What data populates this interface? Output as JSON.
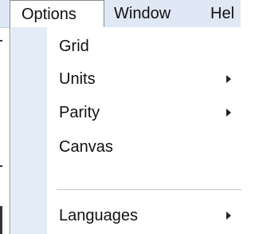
{
  "menubar": {
    "items": [
      {
        "label": "Options"
      },
      {
        "label": "Window"
      },
      {
        "label": "Hel"
      }
    ]
  },
  "dropdown": {
    "items": [
      {
        "label": "Grid",
        "submenu": false
      },
      {
        "label": "Units",
        "submenu": true
      },
      {
        "label": "Parity",
        "submenu": true
      },
      {
        "label": "Canvas",
        "submenu": false
      },
      {
        "label": "Languages",
        "submenu": true
      }
    ]
  },
  "colors": {
    "menubar_bg": "#dfe8f5",
    "gutter_bg": "#e3ecf7",
    "text": "#111111"
  }
}
